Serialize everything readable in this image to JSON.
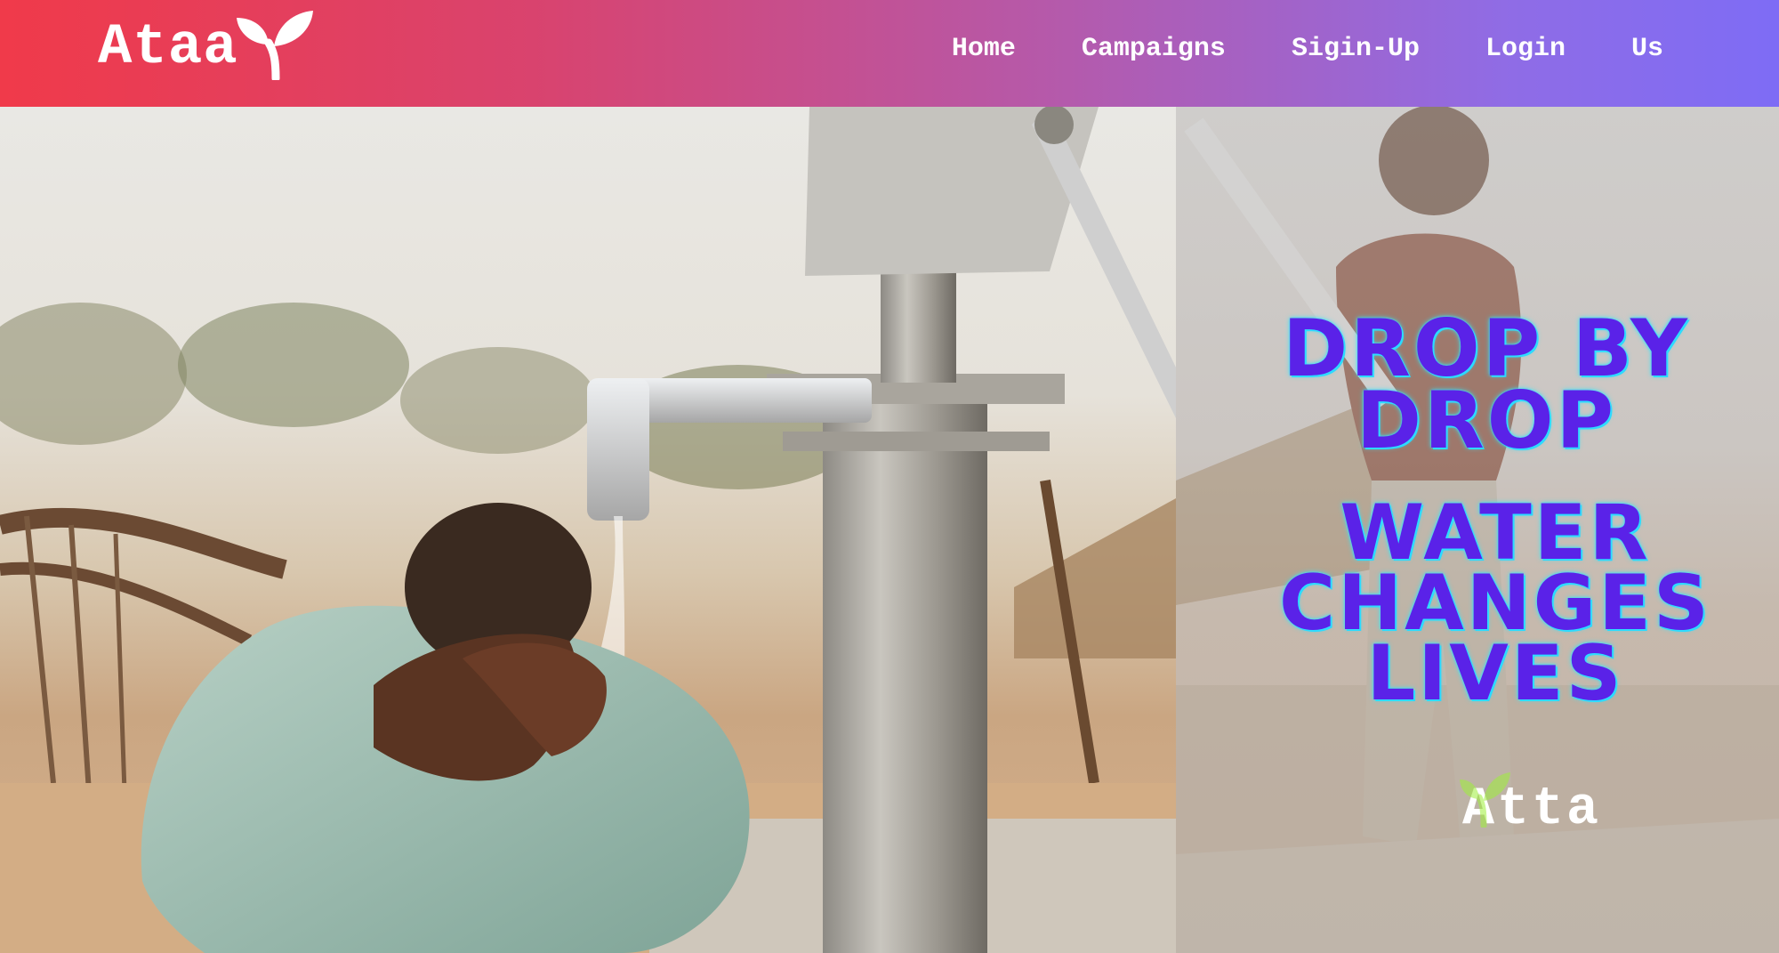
{
  "header": {
    "brand": "Ataa",
    "nav": [
      {
        "label": "Home"
      },
      {
        "label": "Campaigns"
      },
      {
        "label": "Sigin-Up"
      },
      {
        "label": "Login"
      },
      {
        "label": "Us"
      }
    ],
    "gradient_colors": [
      "#f03a4a",
      "#b45aac",
      "#7e6cf5"
    ]
  },
  "hero": {
    "slogan_1": "Drop By Drop",
    "slogan_2": "Water Changes Lives",
    "slogan_color": "#5a22e8",
    "slogan_glow_color": "#32e4ff",
    "footer_brand": "Atta",
    "sprout_icon": "sprout-icon",
    "sprout_color_header": "#ffffff",
    "sprout_color_footer": "#9ef03a"
  }
}
